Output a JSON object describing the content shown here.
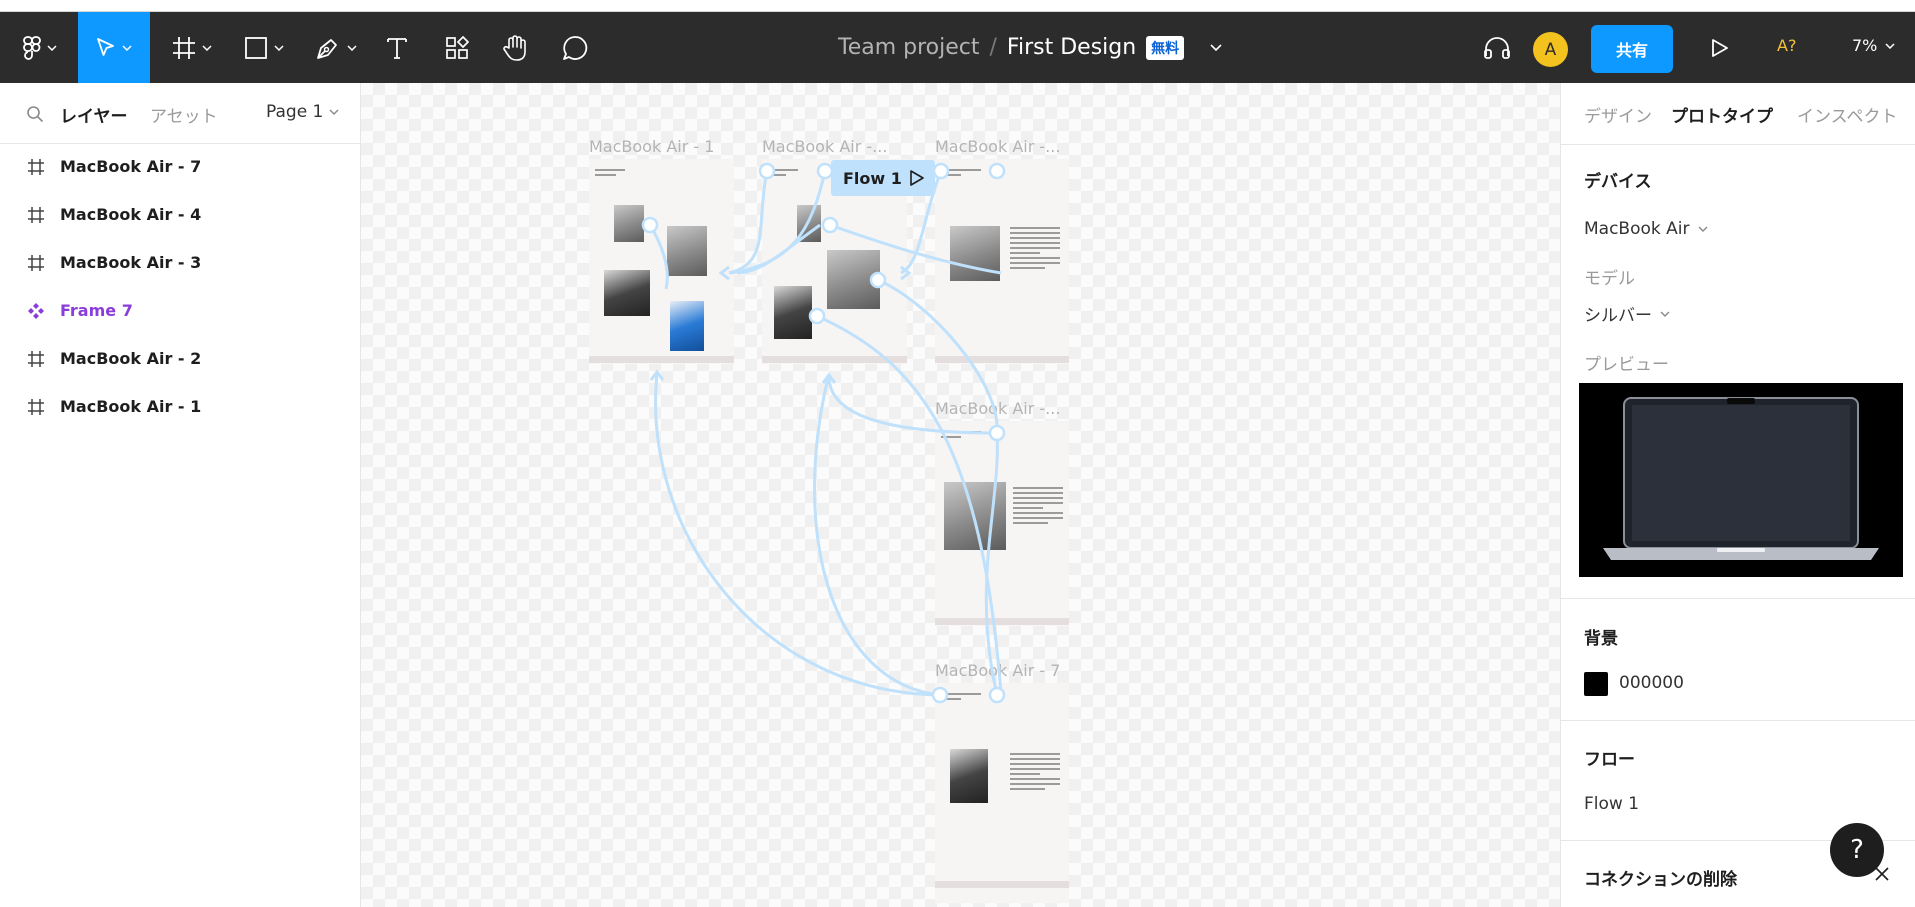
{
  "toolbar": {
    "project": "Team project",
    "separator": "/",
    "file_name": "First Design",
    "plan_badge": "無料",
    "avatar_initial": "A",
    "share_label": "共有",
    "ai_label": "A?",
    "zoom_level": "7%",
    "accent": "#0d99ff",
    "tools": [
      "figma-menu-icon",
      "move-icon",
      "frame-icon",
      "rectangle-icon",
      "pen-icon",
      "text-icon",
      "resources-icon",
      "hand-icon",
      "comment-icon"
    ]
  },
  "left_panel": {
    "tab_layers": "レイヤー",
    "tab_assets": "アセット",
    "page_label": "Page 1",
    "layers": [
      {
        "label": "MacBook Air - 7",
        "icon": "frame-icon"
      },
      {
        "label": "MacBook Air - 4",
        "icon": "frame-icon"
      },
      {
        "label": "MacBook Air - 3",
        "icon": "frame-icon"
      },
      {
        "label": "Frame 7",
        "icon": "component-icon"
      },
      {
        "label": "MacBook Air - 2",
        "icon": "frame-icon"
      },
      {
        "label": "MacBook Air - 1",
        "icon": "frame-icon"
      }
    ]
  },
  "canvas": {
    "frames": [
      {
        "title": "MacBook Air - 1"
      },
      {
        "title": "MacBook Air -..."
      },
      {
        "title": "MacBook Air -..."
      },
      {
        "title": "MacBook Air -..."
      },
      {
        "title": "MacBook Air - 7"
      }
    ],
    "flow_label": "Flow 1",
    "connector_color": "#bfe1fb"
  },
  "right_panel": {
    "tab_design": "デザイン",
    "tab_prototype": "プロトタイプ",
    "tab_inspect": "インスペクト",
    "device_heading": "デバイス",
    "device_value": "MacBook Air",
    "model_label": "モデル",
    "model_value": "シルバー",
    "preview_label": "プレビュー",
    "background_heading": "背景",
    "background_value": "000000",
    "flow_heading": "フロー",
    "flow_value": "Flow 1",
    "delete_connections_heading": "コネクションの削除"
  },
  "help_label": "?"
}
